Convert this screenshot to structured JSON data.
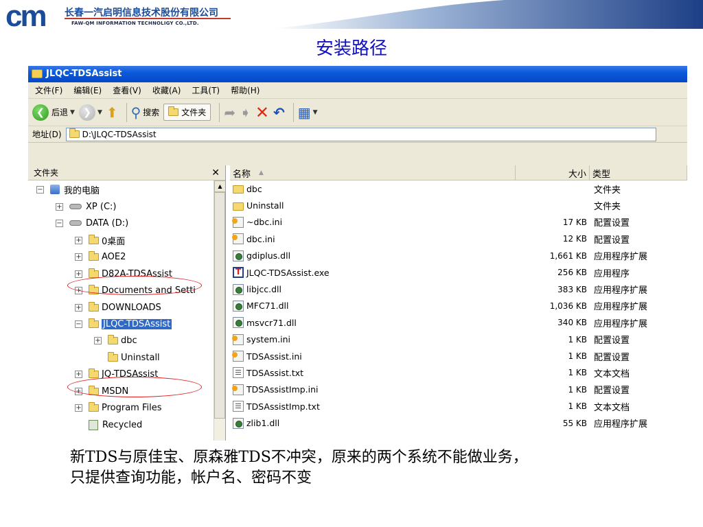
{
  "slide": {
    "company_cn": "长春一汽启明信息技术股份有限公司",
    "company_en": "FAW-QM INFORMATION TECHNOLIGY CO.,LTD.",
    "title": "安装路径",
    "caption_line1": "新TDS与原佳宝、原森雅TDS不冲突，原来的两个系统不能做业务，",
    "caption_line2": "只提供查询功能，帐户名、密码不变"
  },
  "window": {
    "title": "JLQC-TDSAssist",
    "menu": [
      "文件(F)",
      "编辑(E)",
      "查看(V)",
      "收藏(A)",
      "工具(T)",
      "帮助(H)"
    ],
    "toolbar": {
      "back_label": "后退",
      "search_label": "搜索",
      "folders_label": "文件夹"
    },
    "address": {
      "label": "地址(D)",
      "value": "D:\\JLQC-TDSAssist"
    },
    "folder_pane": {
      "title": "文件夹",
      "close_glyph": "✕",
      "tree": [
        {
          "label": "我的电脑",
          "pm": "−",
          "icon": "computer-icon"
        },
        {
          "label": "XP (C:)",
          "pm": "+",
          "icon": "drive-icon"
        },
        {
          "label": "DATA (D:)",
          "pm": "−",
          "icon": "drive-icon"
        },
        {
          "label": "0桌面",
          "pm": "+",
          "icon": "folder-icon"
        },
        {
          "label": "AOE2",
          "pm": "+",
          "icon": "folder-icon"
        },
        {
          "label": "D82A-TDSAssist",
          "pm": "+",
          "icon": "folder-icon"
        },
        {
          "label": "Documents and Setti",
          "pm": "+",
          "icon": "folder-icon"
        },
        {
          "label": "DOWNLOADS",
          "pm": "+",
          "icon": "folder-icon"
        },
        {
          "label": "JLQC-TDSAssist",
          "pm": "−",
          "icon": "folder-icon",
          "selected": true
        },
        {
          "label": "dbc",
          "pm": "+",
          "icon": "folder-icon"
        },
        {
          "label": "Uninstall",
          "pm": "",
          "icon": "folder-icon"
        },
        {
          "label": "JQ-TDSAssist",
          "pm": "+",
          "icon": "folder-icon"
        },
        {
          "label": "MSDN",
          "pm": "+",
          "icon": "folder-icon"
        },
        {
          "label": "Program Files",
          "pm": "+",
          "icon": "folder-icon"
        },
        {
          "label": "Recycled",
          "pm": "",
          "icon": "recycle-icon"
        }
      ]
    },
    "file_list": {
      "columns": {
        "name": "名称",
        "size": "大小",
        "type": "类型"
      },
      "rows": [
        {
          "name": "dbc",
          "size": "",
          "type": "文件夹",
          "icon": "folder"
        },
        {
          "name": "Uninstall",
          "size": "",
          "type": "文件夹",
          "icon": "folder"
        },
        {
          "name": "~dbc.ini",
          "size": "17 KB",
          "type": "配置设置",
          "icon": "ini"
        },
        {
          "name": "dbc.ini",
          "size": "12 KB",
          "type": "配置设置",
          "icon": "ini"
        },
        {
          "name": "gdiplus.dll",
          "size": "1,661 KB",
          "type": "应用程序扩展",
          "icon": "dll"
        },
        {
          "name": "JLQC-TDSAssist.exe",
          "size": "256 KB",
          "type": "应用程序",
          "icon": "exe"
        },
        {
          "name": "libjcc.dll",
          "size": "383 KB",
          "type": "应用程序扩展",
          "icon": "dll"
        },
        {
          "name": "MFC71.dll",
          "size": "1,036 KB",
          "type": "应用程序扩展",
          "icon": "dll"
        },
        {
          "name": "msvcr71.dll",
          "size": "340 KB",
          "type": "应用程序扩展",
          "icon": "dll"
        },
        {
          "name": "system.ini",
          "size": "1 KB",
          "type": "配置设置",
          "icon": "ini"
        },
        {
          "name": "TDSAssist.ini",
          "size": "1 KB",
          "type": "配置设置",
          "icon": "ini"
        },
        {
          "name": "TDSAssist.txt",
          "size": "1 KB",
          "type": "文本文档",
          "icon": "txt"
        },
        {
          "name": "TDSAssistImp.ini",
          "size": "1 KB",
          "type": "配置设置",
          "icon": "ini"
        },
        {
          "name": "TDSAssistImp.txt",
          "size": "1 KB",
          "type": "文本文档",
          "icon": "txt"
        },
        {
          "name": "zlib1.dll",
          "size": "55 KB",
          "type": "应用程序扩展",
          "icon": "dll"
        }
      ]
    }
  },
  "colors": {
    "brand_blue": "#1b4c9a",
    "title_blue": "#1010c8",
    "highlight_red": "#e02020",
    "selection": "#316ac5"
  }
}
